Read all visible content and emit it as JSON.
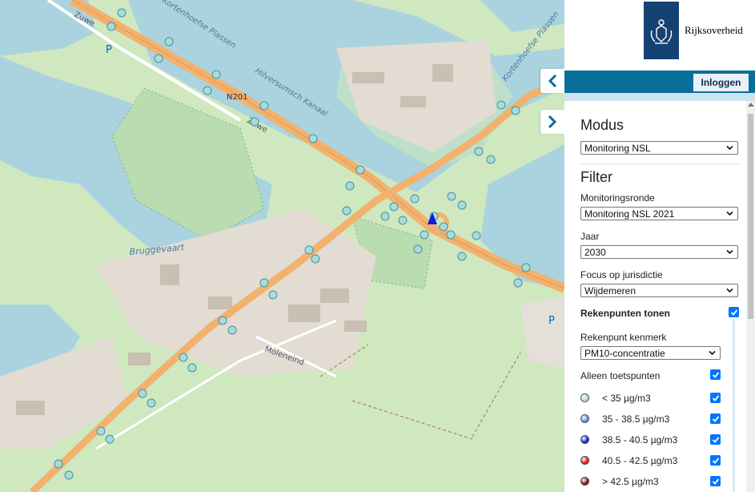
{
  "map": {
    "labels": {
      "street_zuwe": "Zuwe",
      "street_zuwe2": "Zuwe",
      "road_n201": "N201",
      "canal_hilversumsch": "Hilversumsch Kanaal",
      "water_kortenhoefse_top": "Kortenhoefse Plassen",
      "water_kortenhoefse_right": "Kortenhoefse Plassen",
      "water_bruggevaart": "Bruggevaart",
      "street_moleneind": "Moleneind",
      "parking_left": "P",
      "parking_right": "P"
    },
    "marker_colors": {
      "fill": "#a8dcd8",
      "stroke": "#4a8fa0"
    }
  },
  "header": {
    "logo_text": "Rijksoverheid",
    "login_label": "Inloggen"
  },
  "toggles": {
    "collapse_icon": "chevron-left-icon",
    "expand_icon": "chevron-right-icon"
  },
  "panel": {
    "mode_title": "Modus",
    "mode_value": "Monitoring NSL",
    "filter_title": "Filter",
    "round_label": "Monitoringsronde",
    "round_value": "Monitoring NSL 2021",
    "year_label": "Jaar",
    "year_value": "2030",
    "jurisdiction_label": "Focus op jurisdictie",
    "jurisdiction_value": "Wijdemeren",
    "show_points_label": "Rekenpunten tonen",
    "feature_label": "Rekenpunt kenmerk",
    "feature_value": "PM10-concentratie",
    "only_test_label": "Alleen toetspunten",
    "legend": [
      {
        "label": "< 35 µg/m3",
        "color": "#a8dcd8"
      },
      {
        "label": "35 - 38.5 µg/m3",
        "color": "#5b8fd6"
      },
      {
        "label": "38.5 - 40.5 µg/m3",
        "color": "#0a1ed8"
      },
      {
        "label": "40.5 - 42.5 µg/m3",
        "color": "#e01010"
      },
      {
        "label": "> 42.5 µg/m3",
        "color": "#8a0a0a"
      }
    ]
  },
  "colors": {
    "accent": "#0a6e9b",
    "brand": "#154273",
    "checkbox": "#0075ff"
  }
}
